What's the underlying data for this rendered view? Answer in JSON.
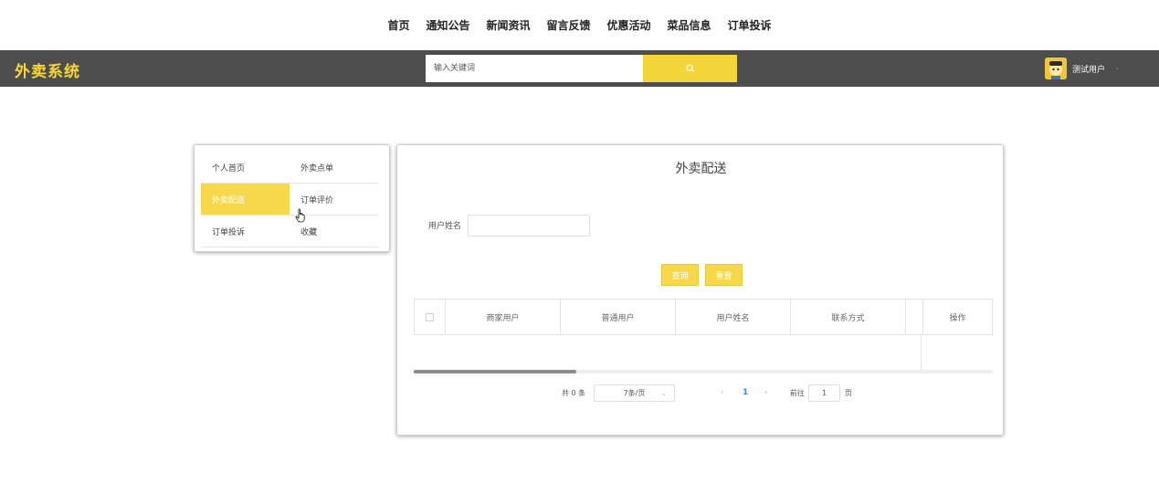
{
  "top_nav": {
    "items": [
      "首页",
      "通知公告",
      "新闻资讯",
      "留言反馈",
      "优惠活动",
      "菜品信息",
      "订单投诉"
    ]
  },
  "header": {
    "brand": "外卖系统",
    "search_placeholder": "输入关键词",
    "search_icon": "search-icon",
    "user_name": "测试用户",
    "user_caret": "·"
  },
  "side_menu": {
    "items": [
      {
        "label": "个人首页",
        "active": false
      },
      {
        "label": "外卖点单",
        "active": false
      },
      {
        "label": "外卖配送",
        "active": true
      },
      {
        "label": "订单评价",
        "active": false
      },
      {
        "label": "订单投诉",
        "active": false
      },
      {
        "label": "收藏",
        "active": false
      }
    ]
  },
  "main": {
    "title": "外卖配送",
    "filter_label": "用户姓名",
    "filter_value": "",
    "query_button": "查询",
    "reset_button": "重置",
    "table": {
      "columns": [
        "商家用户",
        "普通用户",
        "用户姓名",
        "联系方式",
        "操作"
      ],
      "rows": []
    },
    "pagination": {
      "total": "共 0 条",
      "page_size": "7条/页",
      "prev": "‹",
      "current_page": "1",
      "next": "›",
      "goto_label": "前往",
      "goto_value": "1",
      "page_unit": "页"
    }
  },
  "colors": {
    "accent": "#f7d84a",
    "header_bg": "#4d4d4d",
    "brand_text": "#f7d83a",
    "link": "#3b8bd9"
  }
}
